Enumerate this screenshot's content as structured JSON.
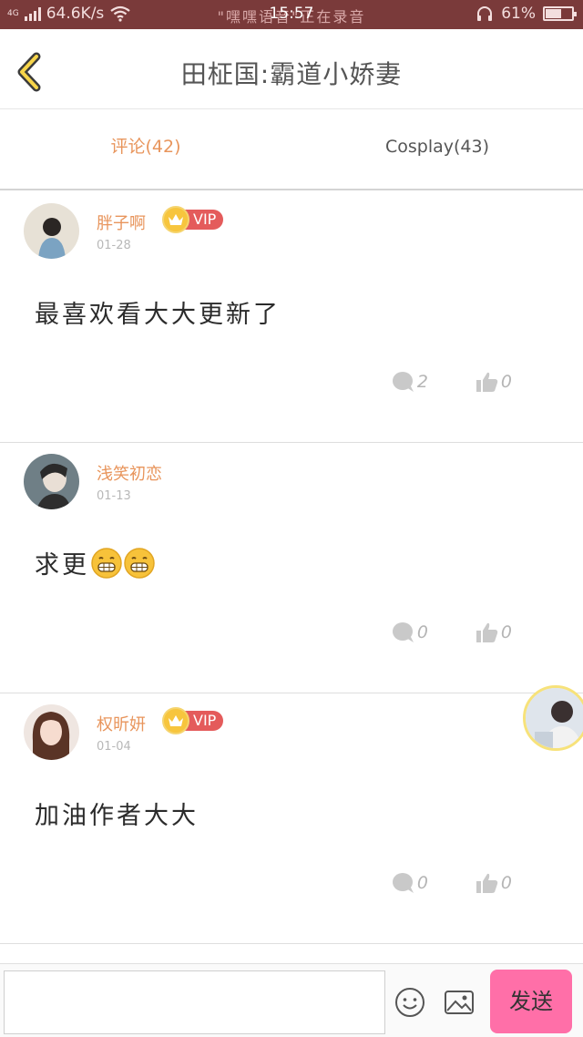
{
  "status_bar": {
    "network_type": "4G",
    "speed": "64.6K/s",
    "recording_text": "\"嘿嘿语音\"正在录音",
    "time": "15:57",
    "battery": "61%",
    "battery_level": 0.61
  },
  "header": {
    "title": "田柾国:霸道小娇妻",
    "back_icon": "chevron-left-icon"
  },
  "tabs": [
    {
      "label": "评论(42)",
      "active": true
    },
    {
      "label": "Cosplay(43)",
      "active": false
    }
  ],
  "vip_label": "VIP",
  "comments": [
    {
      "user": "胖子啊",
      "vip": true,
      "date": "01-28",
      "text": "最喜欢看大大更新了",
      "emoji_count": 0,
      "replies": "2",
      "likes": "0"
    },
    {
      "user": "浅笑初恋",
      "vip": false,
      "date": "01-13",
      "text": "求更",
      "emoji_count": 2,
      "replies": "0",
      "likes": "0"
    },
    {
      "user": "权昕妍",
      "vip": true,
      "date": "01-04",
      "text": "加油作者大大",
      "emoji_count": 0,
      "replies": "0",
      "likes": "0"
    }
  ],
  "input_bar": {
    "placeholder": "",
    "send_label": "发送",
    "emoji_icon": "smiley-icon",
    "image_icon": "image-icon"
  },
  "colors": {
    "accent": "#e8955c",
    "vip_red": "#e45b5b",
    "crown_yellow": "#f7c53d",
    "send_pink": "#ff6fa8",
    "status_bar": "#7a3a3a"
  }
}
